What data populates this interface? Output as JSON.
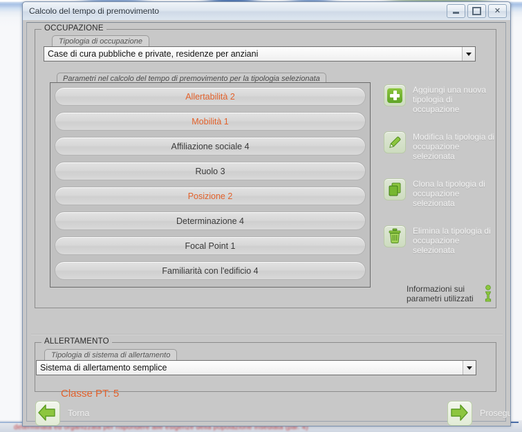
{
  "window": {
    "title": "Calcolo del tempo di premovimento",
    "buttons": {
      "minimize_label": "–",
      "maximize_label": "❐",
      "close_label": "✕"
    }
  },
  "occupazione": {
    "group_title": "OCCUPAZIONE",
    "tipologia": {
      "label": "Tipologia di occupazione",
      "value": "Case di cura pubbliche e private, residenze per anziani"
    },
    "params": {
      "label": "Parametri nel calcolo del tempo di premovimento per la tipologia selezionata",
      "items": [
        {
          "text": "Allertabilità 2",
          "highlight": true
        },
        {
          "text": "Mobilità 1",
          "highlight": true
        },
        {
          "text": "Affiliazione sociale 4",
          "highlight": false
        },
        {
          "text": "Ruolo 3",
          "highlight": false
        },
        {
          "text": "Posizione 2",
          "highlight": true
        },
        {
          "text": "Determinazione 4",
          "highlight": false
        },
        {
          "text": "Focal Point 1",
          "highlight": false
        },
        {
          "text": "Familiarità con l'edificio 4",
          "highlight": false
        }
      ]
    },
    "actions": [
      {
        "icon": "plus-icon",
        "label": "Aggiungi una nuova\ntipologia di occupazione"
      },
      {
        "icon": "pencil-icon",
        "label": "Modifica la tipologia di\noccupazione selezionata"
      },
      {
        "icon": "copy-icon",
        "label": "Clona la tipologia di\noccupazione selezionata"
      },
      {
        "icon": "trash-icon",
        "label": "Elimina la tipologia di\noccupazione selezionata"
      }
    ],
    "info": {
      "label": "Informazioni sui\nparametri utilizzati",
      "icon": "info-icon"
    }
  },
  "allertamento": {
    "group_title": "ALLERTAMENTO",
    "tipologia": {
      "label": "Tipologia di sistema di allertamento",
      "value": "Sistema di allertamento semplice"
    },
    "classe_pt": "Classe PT: 5"
  },
  "nav": {
    "back": {
      "label": "Torna",
      "icon": "arrow-left-icon"
    },
    "next": {
      "label": "Prosegui",
      "icon": "arrow-right-icon"
    }
  },
  "status_strip": {
    "text": "determinata ed organizzata per rispondere alle esigenze della popolazione insediata (par. 4)"
  },
  "colors": {
    "highlight": "#e2622c",
    "icon_green": "#7ab62f",
    "window_face": "#c8c8c8"
  }
}
